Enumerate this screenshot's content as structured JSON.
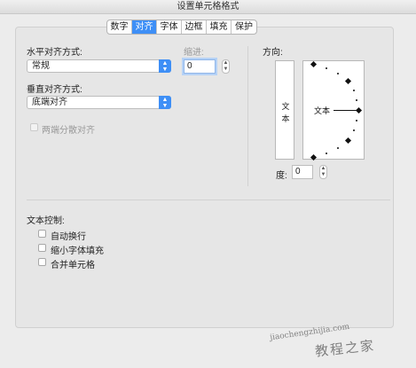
{
  "window": {
    "title": "设置单元格格式"
  },
  "tabs": [
    {
      "label": "数字",
      "active": false
    },
    {
      "label": "对齐",
      "active": true
    },
    {
      "label": "字体",
      "active": false
    },
    {
      "label": "边框",
      "active": false
    },
    {
      "label": "填充",
      "active": false
    },
    {
      "label": "保护",
      "active": false
    }
  ],
  "alignment": {
    "horizontal_label": "水平对齐方式:",
    "horizontal_value": "常规",
    "indent_label": "缩进:",
    "indent_value": "0",
    "vertical_label": "垂直对齐方式:",
    "vertical_value": "底端对齐",
    "distributed_label": "两端分散对齐"
  },
  "orientation": {
    "label": "方向:",
    "vertical_text_chars": [
      "文",
      "本"
    ],
    "dial_text": "文本",
    "degree_label": "度:",
    "degree_value": "0"
  },
  "text_control": {
    "label": "文本控制:",
    "options": [
      {
        "label": "自动换行",
        "checked": false
      },
      {
        "label": "缩小字体填充",
        "checked": false
      },
      {
        "label": "合并单元格",
        "checked": false
      }
    ]
  },
  "watermark": {
    "url": "jiaochengzhijia.com",
    "site": "教程之家"
  },
  "colors": {
    "accent": "#3e8ff6",
    "panel": "#e6e6e6",
    "window": "#ececec"
  }
}
